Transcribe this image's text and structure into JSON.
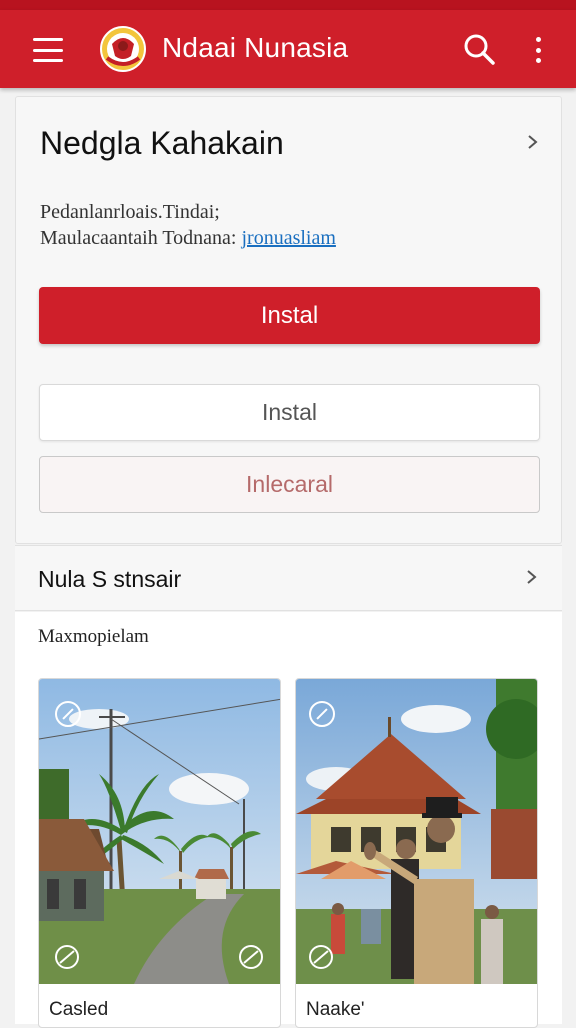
{
  "app": {
    "title": "Ndaai Nunasia",
    "icons": {
      "menu": "hamburger-menu-icon",
      "logo": "emblem-logo",
      "search": "search-icon",
      "more": "more-vert-icon"
    },
    "brand_color": "#cf1f2a"
  },
  "card": {
    "title": "Nedgla Kahakain",
    "info_line1": "Pedanlanrloais.Tindai;",
    "info_line2_text": "Maulacaantaih Todnana: ",
    "info_line2_link": "jronuasliam",
    "primary_button": "Instal",
    "secondary_button": "Instal",
    "outline_button": "Inlecaral"
  },
  "section": {
    "title": "Nula S stnsair",
    "subtitle": "Maxmopielam"
  },
  "photos": [
    {
      "caption": "Casled",
      "scene": "village-road-palms"
    },
    {
      "caption": "Naake'",
      "scene": "traditional-house-people"
    }
  ]
}
